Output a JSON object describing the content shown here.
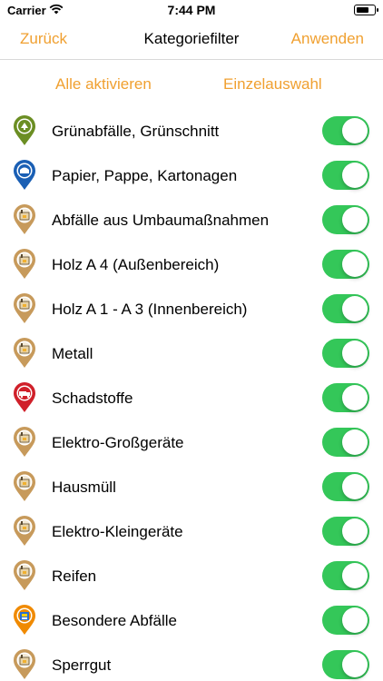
{
  "status_bar": {
    "carrier": "Carrier",
    "time": "7:44 PM",
    "battery_level": 0.7
  },
  "nav": {
    "back_label": "Zurück",
    "title": "Kategoriefilter",
    "apply_label": "Anwenden"
  },
  "modes": {
    "all_label": "Alle aktivieren",
    "single_label": "Einzelauswahl"
  },
  "colors": {
    "accent": "#f0a030",
    "toggle_on": "#34c759",
    "pin_green": "#6b8e23",
    "pin_blue": "#1a5fb4",
    "pin_tan": "#c79a5b",
    "pin_red": "#d0202a",
    "pin_orange": "#f08a00"
  },
  "categories": [
    {
      "label": "Grünabfälle, Grünschnitt",
      "pin_color": "#6b8e23",
      "icon": "green-waste-icon",
      "enabled": true
    },
    {
      "label": "Papier, Pappe, Kartonagen",
      "pin_color": "#1a5fb4",
      "icon": "paper-icon",
      "enabled": true
    },
    {
      "label": "Abfälle aus Umbaumaßnahmen",
      "pin_color": "#c79a5b",
      "icon": "container-icon",
      "enabled": true
    },
    {
      "label": "Holz A 4 (Außenbereich)",
      "pin_color": "#c79a5b",
      "icon": "container-icon",
      "enabled": true
    },
    {
      "label": "Holz A 1 - A 3 (Innenbereich)",
      "pin_color": "#c79a5b",
      "icon": "container-icon",
      "enabled": true
    },
    {
      "label": "Metall",
      "pin_color": "#c79a5b",
      "icon": "container-icon",
      "enabled": true
    },
    {
      "label": "Schadstoffe",
      "pin_color": "#d0202a",
      "icon": "hazmat-truck-icon",
      "enabled": true
    },
    {
      "label": "Elektro-Großgeräte",
      "pin_color": "#c79a5b",
      "icon": "container-icon",
      "enabled": true
    },
    {
      "label": "Hausmüll",
      "pin_color": "#c79a5b",
      "icon": "container-icon",
      "enabled": true
    },
    {
      "label": "Elektro-Kleingeräte",
      "pin_color": "#c79a5b",
      "icon": "container-icon",
      "enabled": true
    },
    {
      "label": "Reifen",
      "pin_color": "#c79a5b",
      "icon": "container-icon",
      "enabled": true
    },
    {
      "label": "Besondere Abfälle",
      "pin_color": "#f08a00",
      "icon": "special-waste-icon",
      "enabled": true
    },
    {
      "label": "Sperrgut",
      "pin_color": "#c79a5b",
      "icon": "container-icon",
      "enabled": true
    }
  ]
}
